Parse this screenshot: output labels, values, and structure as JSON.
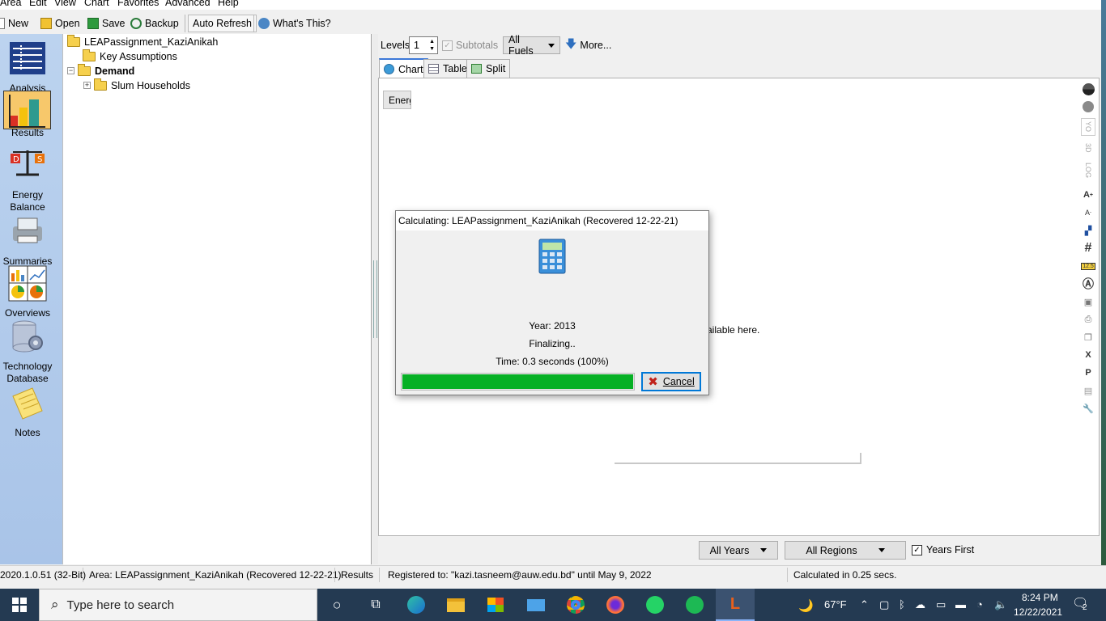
{
  "menu": [
    "Area",
    "Edit",
    "View",
    "Chart",
    "Favorites",
    "Advanced",
    "Help"
  ],
  "toolbar": {
    "new": "New",
    "open": "Open",
    "save": "Save",
    "backup": "Backup",
    "auto_refresh": "Auto Refresh",
    "whats_this": "What's This?"
  },
  "sidebar": {
    "items": [
      {
        "label": "Analysis",
        "icon": "analysis-icon"
      },
      {
        "label": "Results",
        "icon": "results-icon"
      },
      {
        "label": "Energy Balance",
        "icon": "energy-balance-icon"
      },
      {
        "label": "Summaries",
        "icon": "summaries-icon"
      },
      {
        "label": "Overviews",
        "icon": "overviews-icon"
      },
      {
        "label": "Technology Database",
        "icon": "technology-database-icon"
      },
      {
        "label": "Notes",
        "icon": "notes-icon"
      }
    ]
  },
  "tree": {
    "root": "LEAPassignment_KaziAnikah",
    "key_assumptions": "Key Assumptions",
    "demand": "Demand",
    "slum_households": "Slum Households"
  },
  "controls": {
    "levels_label": "Levels:",
    "levels_value": "1",
    "subtotals": "Subtotals",
    "fuels": "All Fuels",
    "more": "More...",
    "tabs": [
      "Chart",
      "Table",
      "Split"
    ],
    "energy_button": "Energy",
    "message_fragment": "lts available here.",
    "years": "All Years",
    "regions": "All Regions",
    "years_first": "Years First"
  },
  "right_toolbar": {
    "yo": "YO",
    "three_d": "3D",
    "log": "LOG",
    "number": "12.5"
  },
  "dialog": {
    "title": "Calculating: LEAPassignment_KaziAnikah (Recovered 12-22-21)",
    "year": "Year: 2013",
    "status": "Finalizing..",
    "time": "Time: 0.3 seconds (100%)",
    "progress_fraction": 1.0,
    "cancel": "Cancel"
  },
  "status_bar": {
    "version": "2020.1.0.51 (32-Bit)",
    "area": "Area: LEAPassignment_KaziAnikah (Recovered 12-22-21)",
    "view": "Results",
    "registered": "Registered to: \"kazi.tasneem@auw.edu.bd\" until May 9, 2022",
    "calculated": "Calculated in 0.25 secs."
  },
  "taskbar": {
    "search_placeholder": "Type here to search",
    "weather": "67°F",
    "time": "8:24 PM",
    "date": "12/22/2021",
    "notifications": "2"
  },
  "colors": {
    "progress": "#06b025",
    "sidebar": "#b3cbec",
    "taskbar": "#243a52"
  }
}
